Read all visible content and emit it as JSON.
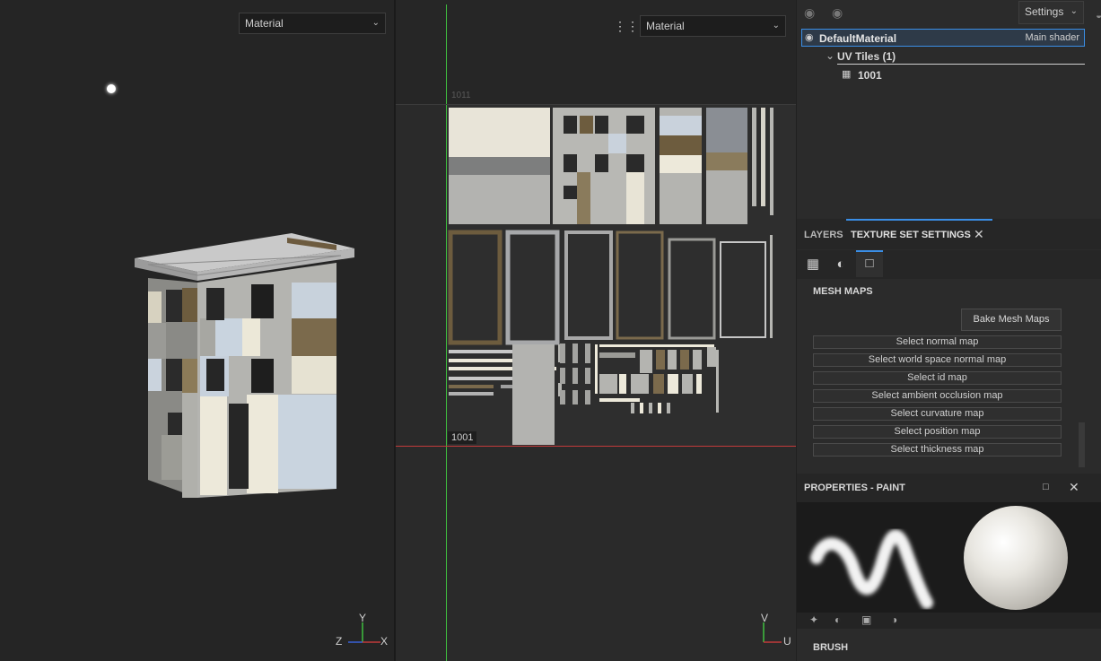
{
  "viewport3d": {
    "dropdown": "Material",
    "axes": {
      "y": "Y",
      "z": "Z",
      "x": "X"
    }
  },
  "viewport2d": {
    "dropdown": "Material",
    "tile_top": "1011",
    "tile_bottom": "1001",
    "axes": {
      "v": "V",
      "u": "U"
    }
  },
  "texture_set_list": {
    "settings": "Settings",
    "material": "DefaultMaterial",
    "shader": "Main shader",
    "uv_tiles": "UV Tiles (1)",
    "tile": "1001"
  },
  "tabs": {
    "layers": "LAYERS",
    "texture_set_settings": "TEXTURE SET SETTINGS"
  },
  "mesh_maps": {
    "title": "MESH MAPS",
    "bake_button": "Bake Mesh Maps",
    "buttons": [
      "Select normal map",
      "Select world space normal map",
      "Select id map",
      "Select ambient occlusion map",
      "Select curvature map",
      "Select position map",
      "Select thickness map"
    ]
  },
  "properties": {
    "title": "PROPERTIES - PAINT",
    "brush": "BRUSH"
  },
  "colors": {
    "accent": "#3a8ee6",
    "uv_vertical_axis": "#3fbf3f",
    "uv_horizontal_axis": "#c23b3b"
  }
}
